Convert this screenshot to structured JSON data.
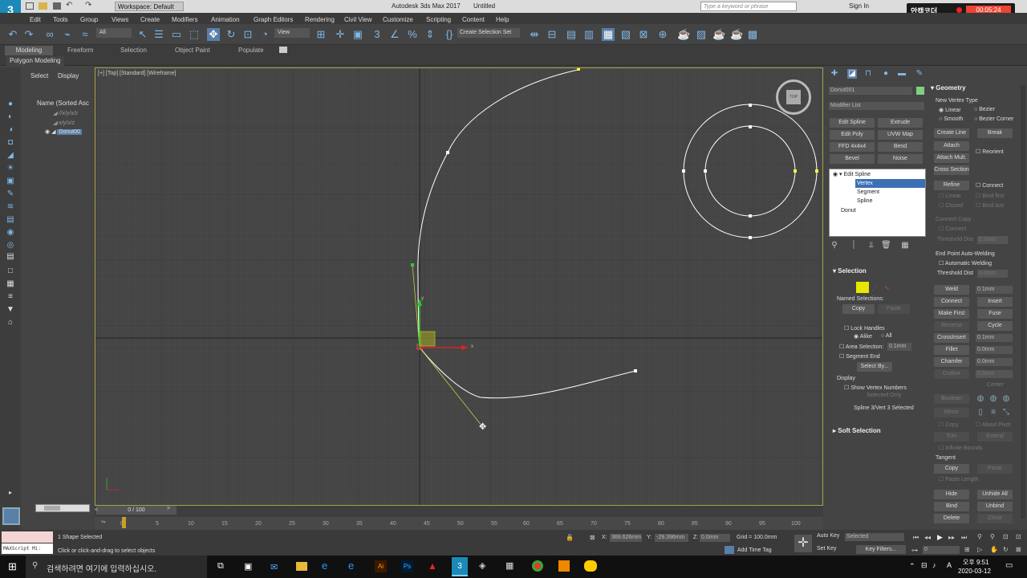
{
  "title_bar": {
    "app_title": "Autodesk 3ds Max 2017",
    "doc_title": "Untitled",
    "workspace": "Workspace: Default",
    "search_placeholder": "Type a keyword or phrase",
    "sign_in": "Sign In",
    "recorder_label": "안캠코더",
    "recorder_time": "00:05:24"
  },
  "menu": [
    "Edit",
    "Tools",
    "Group",
    "Views",
    "Create",
    "Modifiers",
    "Animation",
    "Graph Editors",
    "Rendering",
    "Civil View",
    "Customize",
    "Scripting",
    "Content",
    "Help"
  ],
  "toolbar": {
    "filter": "All",
    "view": "View",
    "create_selection_set": "Create Selection Set"
  },
  "ribbon": {
    "tabs": [
      "Modeling",
      "Freeform",
      "Selection",
      "Object Paint",
      "Populate"
    ],
    "sub_label": "Polygon Modeling"
  },
  "scene_explorer": {
    "tabs": [
      "Select",
      "Display"
    ],
    "column": "Name (Sorted Asc",
    "items": [
      "//x/y/x/z",
      "x/y/x/z",
      "Donut00"
    ]
  },
  "viewport": {
    "label": "[+] [Top] [Standard] [Wireframe]",
    "viewcube": "TOP",
    "gizmo_x": "x",
    "gizmo_y": "y"
  },
  "command_panel": {
    "object_name": "Donut001",
    "modifier_list": "Modifier List",
    "modifier_buttons": [
      "Edit Spline",
      "Extrude",
      "Edit Poly",
      "UVW Map",
      "FFD 4x4x4",
      "Bend",
      "Bevel",
      "Noise"
    ],
    "stack": {
      "edit_spline": "Edit Spline",
      "vertex": "Vertex",
      "segment": "Segment",
      "spline": "Spline",
      "donut": "Donut"
    },
    "selection": {
      "header": "Selection",
      "named_selections": "Named Selections:",
      "copy": "Copy",
      "paste": "Paste",
      "lock_handles": "Lock Handles",
      "alike": "Alike",
      "all": "All",
      "area_selection": "Area Selection:",
      "area_value": "0.1mm",
      "segment_end": "Segment End",
      "select_by": "Select By...",
      "display": "Display",
      "show_vertex_numbers": "Show Vertex Numbers",
      "selected_only": "Selected Only",
      "status": "Spline 3/Vert 3 Selected"
    },
    "soft_selection": "Soft Selection"
  },
  "geometry": {
    "header": "Geometry",
    "new_vertex_type": "New Vertex Type",
    "linear": "Linear",
    "bezier": "Bezier",
    "smooth": "Smooth",
    "bezier_corner": "Bezier Corner",
    "create_line": "Create Line",
    "break": "Break",
    "attach": "Attach",
    "reorient": "Reorient",
    "attach_mult": "Attach Mult.",
    "cross_section": "Cross Section",
    "refine": "Refine",
    "connect": "Connect",
    "linear2": "Linear",
    "bind_first": "Bind first",
    "closed": "Closed",
    "bind_last": "Bind last",
    "connect_copy": "Connect Copy",
    "connect2": "Connect",
    "threshold_dist": "Threshold Dist",
    "threshold_value": "0.1mm",
    "end_point_auto_welding": "End Point Auto-Welding",
    "automatic_welding": "Automatic Welding",
    "threshold_dist2": "Threshold Dist",
    "threshold_value2": "6.0mm",
    "weld": "Weld",
    "weld_value": "0.1mm",
    "connect3": "Connect",
    "insert": "Insert",
    "make_first": "Make First",
    "fuse": "Fuse",
    "reverse": "Reverse",
    "cycle": "Cycle",
    "crossinsert": "CrossInsert",
    "crossinsert_value": "0.1mm",
    "fillet": "Fillet",
    "fillet_value": "0.0mm",
    "chamfer": "Chamfer",
    "chamfer_value": "0.0mm",
    "outline": "Outline",
    "outline_value": "0.0mm",
    "center": "Center",
    "boolean": "Boolean",
    "mirror": "Mirror",
    "copy": "Copy",
    "about_pivot": "About Pivot",
    "trim": "Trim",
    "extend": "Extend",
    "infinite_bounds": "Infinite Bounds",
    "tangent": "Tangent",
    "tangent_copy": "Copy",
    "tangent_paste": "Paste",
    "paste_length": "Paste Length",
    "hide": "Hide",
    "unhide_all": "Unhide All",
    "bind": "Bind",
    "unbind": "Unbind",
    "delete": "Delete",
    "close": "Close"
  },
  "timeline": {
    "frame_counter": "0 / 100",
    "ticks": [
      "0",
      "5",
      "10",
      "15",
      "20",
      "25",
      "30",
      "35",
      "40",
      "45",
      "50",
      "55",
      "60",
      "65",
      "70",
      "75",
      "80",
      "85",
      "90",
      "95",
      "100"
    ]
  },
  "status": {
    "maxscript": "MAXScript Mi:",
    "selected": "1 Shape Selected",
    "prompt": "Click or click-and-drag to select objects",
    "x": "369.626mm",
    "y": "-29.396mm",
    "z": "0.0mm",
    "grid": "Grid = 100.0mm",
    "add_time_tag": "Add Time Tag",
    "auto_key": "Auto Key",
    "selected_dropdown": "Selected",
    "set_key": "Set Key",
    "key_filters": "Key Filters...",
    "frame": "0"
  },
  "taskbar": {
    "search_placeholder": "검색하려면 여기에 입력하십시오.",
    "time": "오후 9:51",
    "date": "2020-03-12",
    "lang": "A"
  }
}
